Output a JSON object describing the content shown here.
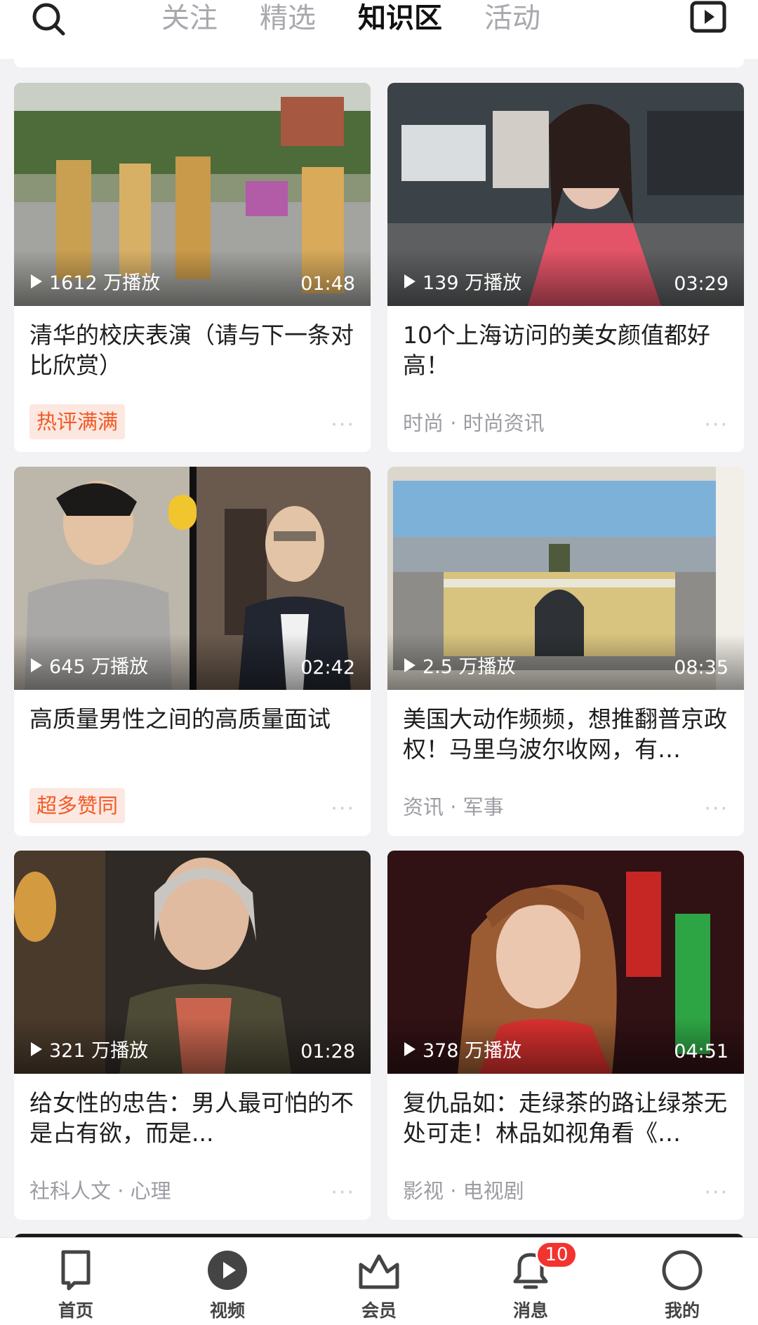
{
  "header": {
    "tabs": [
      {
        "label": "关注"
      },
      {
        "label": "精选"
      },
      {
        "label": "知识区"
      },
      {
        "label": "活动"
      }
    ],
    "active_tab": "知识区"
  },
  "cards": [
    {
      "plays": "1612 万播放",
      "duration": "01:48",
      "title": "清华的校庆表演（请与下一条对比欣赏）",
      "badge": "热评满满",
      "more": "···"
    },
    {
      "plays": "139 万播放",
      "duration": "03:29",
      "title": "10个上海访问的美女颜值都好高！",
      "category": "时尚 · 时尚资讯",
      "more": "···"
    },
    {
      "plays": "645 万播放",
      "duration": "02:42",
      "title": "高质量男性之间的高质量面试",
      "badge": "超多赞同",
      "more": "···"
    },
    {
      "plays": "2.5 万播放",
      "duration": "08:35",
      "title": "美国大动作频频，想推翻普京政权！马里乌波尔收网，有…",
      "category": "资讯 · 军事",
      "more": "···"
    },
    {
      "plays": "321 万播放",
      "duration": "01:28",
      "title": "给女性的忠告：男人最可怕的不是占有欲，而是...",
      "category": "社科人文 · 心理",
      "more": "···"
    },
    {
      "plays": "378 万播放",
      "duration": "04:51",
      "title": "复仇品如：走绿茶的路让绿茶无处可走！林品如视角看《…",
      "category": "影视 · 电视剧",
      "more": "···"
    }
  ],
  "bottom_nav": [
    {
      "label": "首页",
      "icon": "home-icon"
    },
    {
      "label": "视频",
      "icon": "video-play-icon"
    },
    {
      "label": "会员",
      "icon": "crown-icon"
    },
    {
      "label": "消息",
      "icon": "bell-icon",
      "badge": "10"
    },
    {
      "label": "我的",
      "icon": "profile-icon"
    }
  ],
  "colors": {
    "accent": "#1e7cf2",
    "badge_bg": "#fde7e1",
    "badge_text": "#f15a24",
    "notification": "#f3332f"
  }
}
